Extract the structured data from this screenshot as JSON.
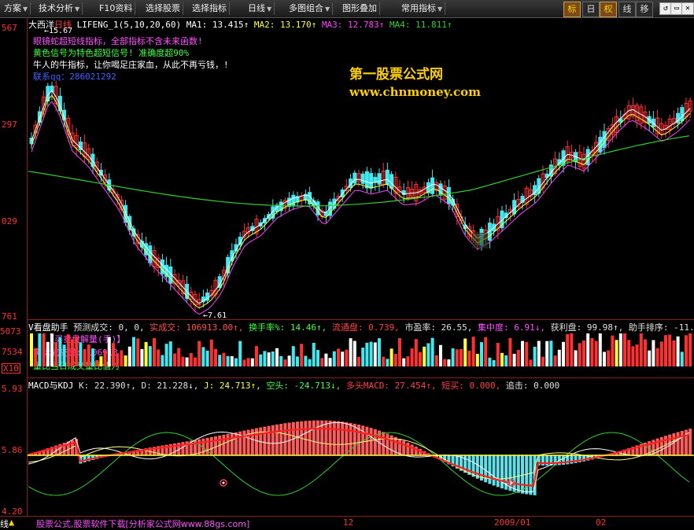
{
  "toolbar": {
    "items": [
      {
        "label": "方案",
        "caret": "▼"
      },
      {
        "label": "技术分析",
        "caret": "▼"
      },
      {
        "label": "F10资料",
        "caret": ""
      },
      {
        "label": "选择股票",
        "caret": ""
      },
      {
        "label": "选择指标",
        "caret": ""
      },
      {
        "label": "日线",
        "caret": "▼"
      },
      {
        "label": "多图组合",
        "caret": "▼"
      },
      {
        "label": "图形叠加",
        "caret": ""
      },
      {
        "label": "常用指标",
        "caret": "▼"
      }
    ],
    "buttons": [
      "标",
      "日",
      "权",
      "线",
      "移"
    ],
    "window": [
      "↺",
      "▭",
      "✕"
    ]
  },
  "price_axis": [
    "567",
    "297",
    "029",
    "761"
  ],
  "vol_axis": [
    "5073",
    "7534",
    "X10"
  ],
  "macd_axis": [
    "5.93",
    "5.86",
    "4.20"
  ],
  "header": {
    "title": "大西洋",
    "period": "日线",
    "indicator": "LIFENG_1",
    "params": "(5,10,20,60)",
    "ma1": "MA1: 13.415↑",
    "ma2": "MA2: 13.170↑",
    "ma3": "MA3: 12.783↑",
    "ma4": "MA4: 11.811↑",
    "high_label": "←15.67",
    "low_label": "←7.61"
  },
  "notes": [
    "眼镜蛇超短线指标，全部指标不含未来函数!",
    "黄色信号为特色超短信号! 准确度超90%",
    "牛人的牛指标，让你喝足庄家血，从此不再亏钱，!",
    "联系qq：286021292"
  ],
  "watermark": {
    "line1": "第一股票公式网",
    "line2": "www.chnmoney.com"
  },
  "volume_panel": {
    "label": "V看盘助手",
    "fields": [
      {
        "text": "预测成交: 0,",
        "color": "#e0e0e0"
      },
      {
        "text": "0,",
        "color": "#e0e0e0"
      },
      {
        "text": "实成交: 106913.00↑,",
        "color": "#ff5050"
      },
      {
        "text": "换手率%: 14.46↑,",
        "color": "#40ff40"
      },
      {
        "text": "流通盘: 0.739,",
        "color": "#ff4040"
      },
      {
        "text": "市盈率: 26.55,",
        "color": "#e0e0e0"
      },
      {
        "text": "集中度: 6.91↓,",
        "color": "#ff50ff"
      },
      {
        "text": "获利盘: 99.98↑,",
        "color": "#e0e0e0"
      },
      {
        "text": "助手排序: -11.596↓",
        "color": "#e0e0e0"
      }
    ],
    "sub1": "【买卖盘解量(手)】",
    "sub2": "实际成交量: 106913",
    "sub3": "量比当日成交量比值为"
  },
  "macd_panel": {
    "label": "MACD与KDJ",
    "fields": [
      {
        "text": "K: 22.390↑,",
        "color": "#e0e0e0"
      },
      {
        "text": "D: 21.228↓,",
        "color": "#e0e0e0"
      },
      {
        "text": "J: 24.713↑,",
        "color": "#ffff40"
      },
      {
        "text": "空头: -24.713↓,",
        "color": "#40ff40"
      },
      {
        "text": "多头MACD: 27.454↑,",
        "color": "#ff4040"
      },
      {
        "text": "短买: 0.000,",
        "color": "#ff4040"
      },
      {
        "text": "追击: 0.000",
        "color": "#e0e0e0"
      }
    ]
  },
  "footer": {
    "left": "线",
    "link": "股票公式,股票软件下载[分析家公式网www.88gs.com]",
    "dates": [
      "12",
      "2009/01",
      "02"
    ]
  },
  "colors": {
    "up": "#ff3030",
    "down": "#40e8f0",
    "ma1": "#ffffff",
    "ma2": "#ffff40",
    "ma3": "#ff40ff",
    "ma4": "#30d030"
  }
}
